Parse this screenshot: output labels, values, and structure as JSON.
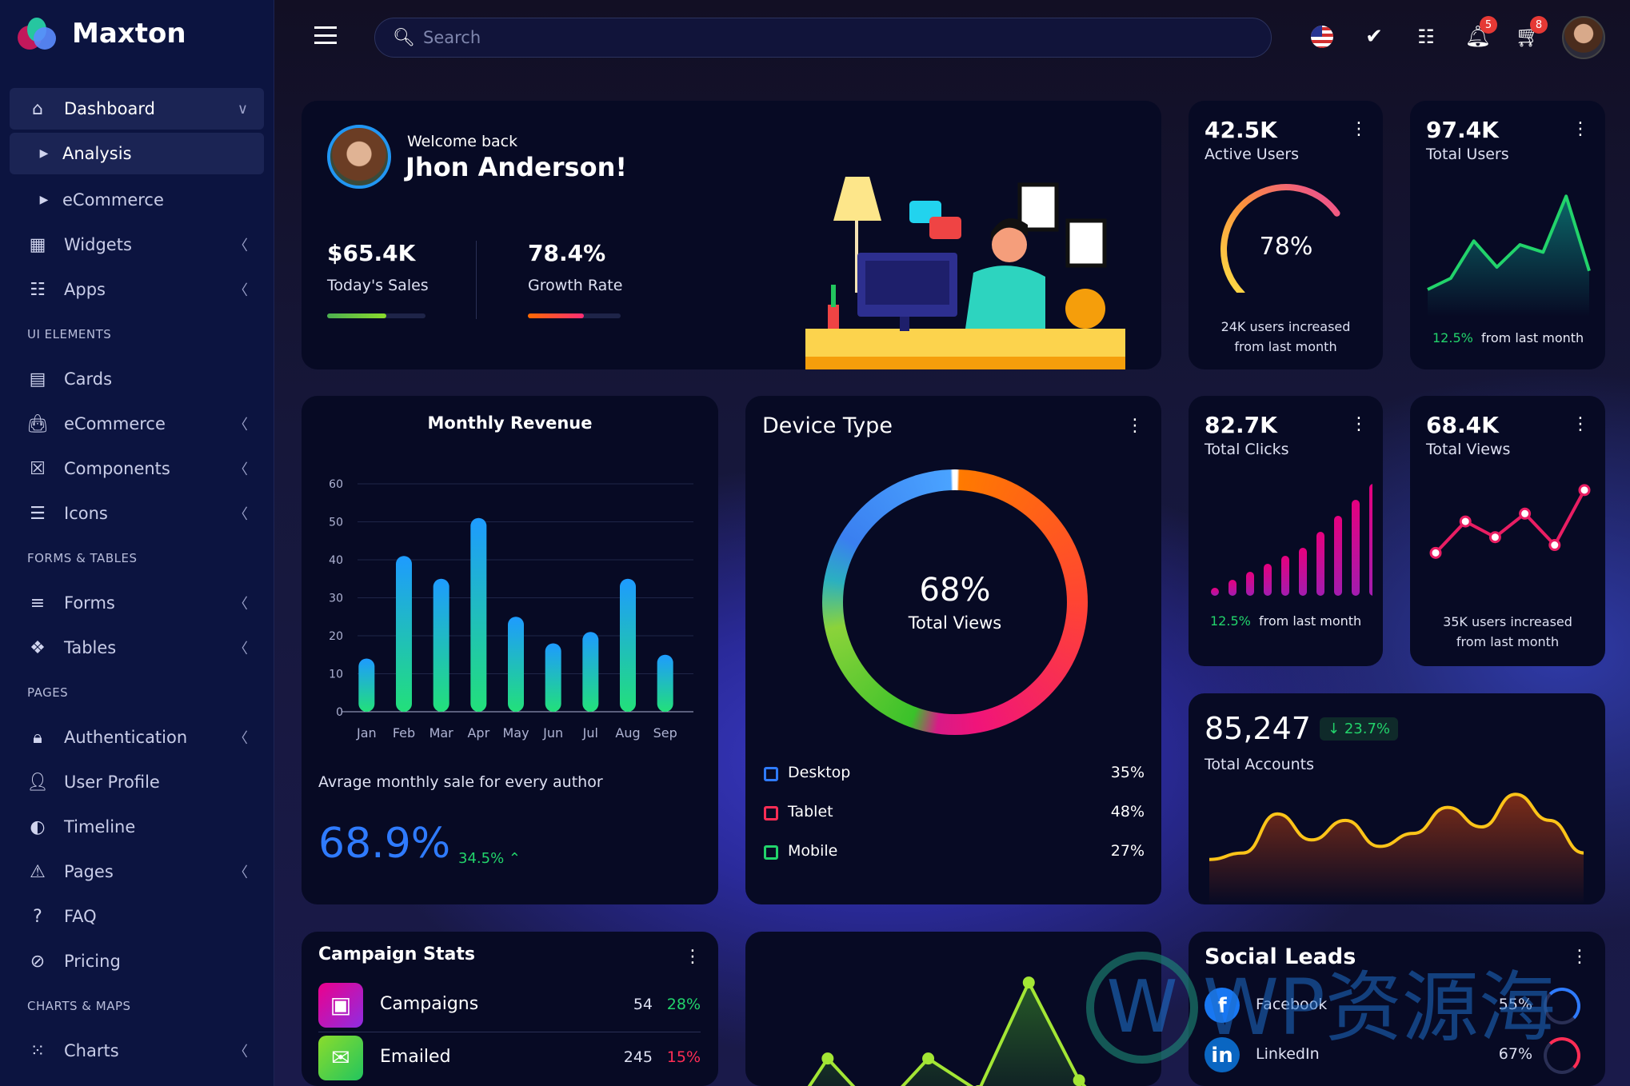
{
  "app": {
    "name": "Maxton"
  },
  "sidebar": {
    "items": [
      {
        "type": "item",
        "label": "Dashboard",
        "icon": "home-icon",
        "chevron": "down",
        "active": true
      },
      {
        "type": "sub",
        "label": "Analysis",
        "active": true
      },
      {
        "type": "sub",
        "label": "eCommerce"
      },
      {
        "type": "item",
        "label": "Widgets",
        "icon": "widgets-icon",
        "chevron": "left"
      },
      {
        "type": "item",
        "label": "Apps",
        "icon": "apps-grid-icon",
        "chevron": "left"
      },
      {
        "type": "section",
        "label": "UI ELEMENTS"
      },
      {
        "type": "item",
        "label": "Cards",
        "icon": "cards-icon"
      },
      {
        "type": "item",
        "label": "eCommerce",
        "icon": "shopping-bag-icon",
        "chevron": "left"
      },
      {
        "type": "item",
        "label": "Components",
        "icon": "components-icon",
        "chevron": "left"
      },
      {
        "type": "item",
        "label": "Icons",
        "icon": "icons-icon",
        "chevron": "left"
      },
      {
        "type": "section",
        "label": "FORMS & TABLES"
      },
      {
        "type": "item",
        "label": "Forms",
        "icon": "forms-icon",
        "chevron": "left"
      },
      {
        "type": "item",
        "label": "Tables",
        "icon": "tables-icon",
        "chevron": "left"
      },
      {
        "type": "section",
        "label": "PAGES"
      },
      {
        "type": "item",
        "label": "Authentication",
        "icon": "lock-icon",
        "chevron": "left"
      },
      {
        "type": "item",
        "label": "User Profile",
        "icon": "user-icon"
      },
      {
        "type": "item",
        "label": "Timeline",
        "icon": "timeline-icon"
      },
      {
        "type": "item",
        "label": "Pages",
        "icon": "warning-icon",
        "chevron": "left"
      },
      {
        "type": "item",
        "label": "FAQ",
        "icon": "help-icon"
      },
      {
        "type": "item",
        "label": "Pricing",
        "icon": "pricing-icon"
      },
      {
        "type": "section",
        "label": "CHARTS & MAPS"
      },
      {
        "type": "item",
        "label": "Charts",
        "icon": "charts-icon",
        "chevron": "left"
      }
    ]
  },
  "topbar": {
    "search_placeholder": "Search",
    "notifications_count": "5",
    "cart_count": "8"
  },
  "welcome": {
    "greeting": "Welcome back",
    "name": "Jhon Anderson!",
    "sales_value": "$65.4K",
    "sales_label": "Today's Sales",
    "sales_progress": 60,
    "growth_value": "78.4%",
    "growth_label": "Growth Rate",
    "growth_progress": 60
  },
  "active_users": {
    "value": "42.5K",
    "label": "Active Users",
    "gauge_percent": 78,
    "gauge_label": "78%",
    "note": "24K users increased",
    "note2": "from last month"
  },
  "total_users": {
    "value": "97.4K",
    "label": "Total Users",
    "change": "12.5%",
    "note": "from last month"
  },
  "total_clicks": {
    "value": "82.7K",
    "label": "Total Clicks",
    "change": "12.5%",
    "note": "from last month"
  },
  "total_views": {
    "value": "68.4K",
    "label": "Total Views",
    "note": "35K users increased",
    "note2": "from last month"
  },
  "total_accounts": {
    "value": "85,247",
    "change": "23.7%",
    "label": "Total Accounts"
  },
  "monthly_revenue": {
    "title": "Monthly Revenue",
    "subtitle": "Avrage monthly sale for every author",
    "percent": "68.9%",
    "change": "34.5%"
  },
  "chart_data": {
    "type": "bar",
    "title": "Monthly Revenue",
    "categories": [
      "Jan",
      "Feb",
      "Mar",
      "Apr",
      "May",
      "Jun",
      "Jul",
      "Aug",
      "Sep"
    ],
    "values": [
      14,
      41,
      35,
      51,
      25,
      18,
      21,
      35,
      15
    ],
    "yticks": [
      0,
      10,
      20,
      30,
      40,
      50,
      60
    ],
    "ylim": [
      0,
      60
    ],
    "grid": true
  },
  "device_type": {
    "title": "Device Type",
    "center_value": "68%",
    "center_label": "Total Views",
    "rows": [
      {
        "label": "Desktop",
        "value": "35%",
        "color": "#2f7bff",
        "icon": "monitor-icon"
      },
      {
        "label": "Tablet",
        "value": "48%",
        "color": "#ff2d55",
        "icon": "tablet-icon"
      },
      {
        "label": "Mobile",
        "value": "27%",
        "color": "#22d36b",
        "icon": "mobile-icon"
      }
    ]
  },
  "campaign_stats": {
    "title": "Campaign Stats",
    "rows": [
      {
        "label": "Campaigns",
        "count": "54",
        "percent": "28%",
        "pcolor": "#22d36b",
        "icon": "calendar-icon"
      },
      {
        "label": "Emailed",
        "count": "245",
        "percent": "15%",
        "pcolor": "#ff2d55",
        "icon": "mail-icon"
      }
    ]
  },
  "social_leads": {
    "title": "Social Leads",
    "rows": [
      {
        "label": "Facebook",
        "percent": "55%",
        "icon": "facebook-icon",
        "color": "#1877f2"
      },
      {
        "label": "LinkedIn",
        "percent": "67%",
        "icon": "linkedin-icon",
        "color": "#0a66c2"
      }
    ]
  },
  "watermark": "WP资源海"
}
